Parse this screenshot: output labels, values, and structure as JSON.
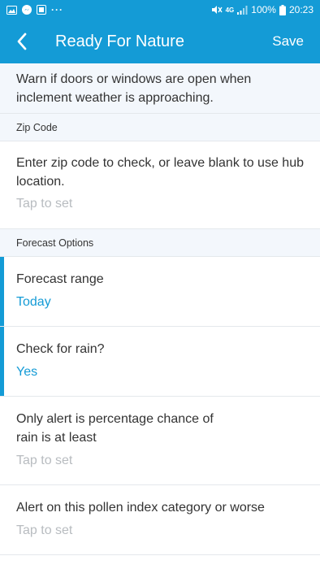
{
  "status_bar": {
    "battery": "100%",
    "time": "20:23",
    "dots": "···",
    "network": "4G"
  },
  "header": {
    "title": "Ready For Nature",
    "save_label": "Save"
  },
  "intro": {
    "text": "Warn if doors or windows are open when inclement weather is approaching."
  },
  "zip_section": {
    "header": "Zip Code",
    "label": "Enter zip code to check, or leave blank to use hub location.",
    "value": "Tap to set"
  },
  "forecast_section": {
    "header": "Forecast Options",
    "items": [
      {
        "label": "Forecast range",
        "value": "Today"
      },
      {
        "label": "Check for rain?",
        "value": "Yes"
      },
      {
        "label": "Only alert is percentage chance of rain is at least",
        "value": "Tap to set"
      },
      {
        "label": "Alert on this pollen index category or worse",
        "value": "Tap to set"
      }
    ]
  },
  "colors": {
    "accent": "#149bd6",
    "section_bg": "#f3f7fc",
    "placeholder": "#b8bcc0",
    "text": "#333333"
  }
}
